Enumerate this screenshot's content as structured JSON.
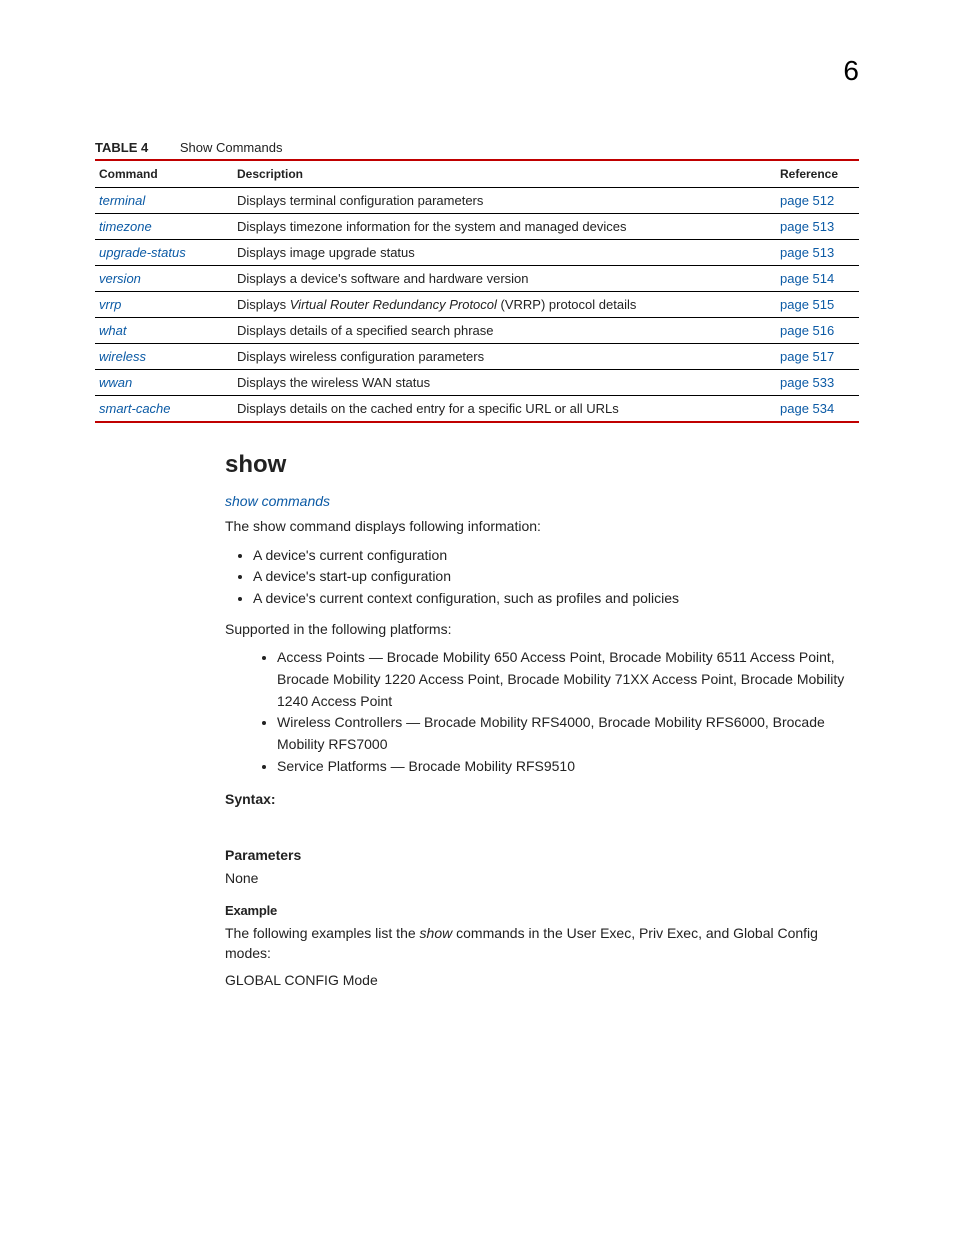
{
  "page_number": "6",
  "table": {
    "label": "TABLE 4",
    "title": "Show Commands",
    "headers": {
      "command": "Command",
      "description": "Description",
      "reference": "Reference"
    },
    "rows": [
      {
        "cmd": "terminal",
        "desc": "Displays terminal configuration parameters",
        "ref": "page 512"
      },
      {
        "cmd": "timezone",
        "desc": "Displays timezone information for the system and managed devices",
        "ref": "page 513"
      },
      {
        "cmd": "upgrade-status",
        "desc": "Displays image upgrade status",
        "ref": "page 513"
      },
      {
        "cmd": "version",
        "desc": "Displays a device's software and hardware version",
        "ref": "page 514"
      },
      {
        "cmd": "vrrp",
        "desc_pre": "Displays ",
        "desc_ital": "Virtual Router Redundancy Protocol",
        "desc_post": " (VRRP) protocol details",
        "ref": "page 515"
      },
      {
        "cmd": "what",
        "desc": "Displays details of a specified search phrase",
        "ref": "page 516"
      },
      {
        "cmd": "wireless",
        "desc": "Displays wireless configuration parameters",
        "ref": "page 517"
      },
      {
        "cmd": "wwan",
        "desc": "Displays the wireless WAN status",
        "ref": "page 533"
      },
      {
        "cmd": "smart-cache",
        "desc": "Displays details on the cached entry for a specific URL or all URLs",
        "ref": "page 534"
      }
    ]
  },
  "section": {
    "heading": "show",
    "sublink": "show commands",
    "intro": "The show command displays following information:",
    "bullets1": [
      "A device's current configuration",
      "A device's start-up configuration",
      "A device's current context configuration, such as profiles and policies"
    ],
    "supported_intro": "Supported in the following platforms:",
    "bullets2": [
      "Access Points — Brocade Mobility 650 Access Point, Brocade Mobility 6511 Access Point, Brocade Mobility 1220 Access Point, Brocade Mobility 71XX Access Point, Brocade Mobility 1240 Access Point",
      "Wireless Controllers — Brocade Mobility RFS4000, Brocade Mobility RFS6000, Brocade Mobility RFS7000",
      "Service Platforms — Brocade Mobility RFS9510"
    ],
    "syntax_head": "Syntax:",
    "params_head": "Parameters",
    "params_body": "None",
    "example_head": "Example",
    "example_intro_pre": "The following examples list the ",
    "example_intro_ital": "show",
    "example_intro_post": " commands in the User Exec, Priv Exec, and Global Config modes:",
    "global_mode": "GLOBAL CONFIG Mode"
  }
}
